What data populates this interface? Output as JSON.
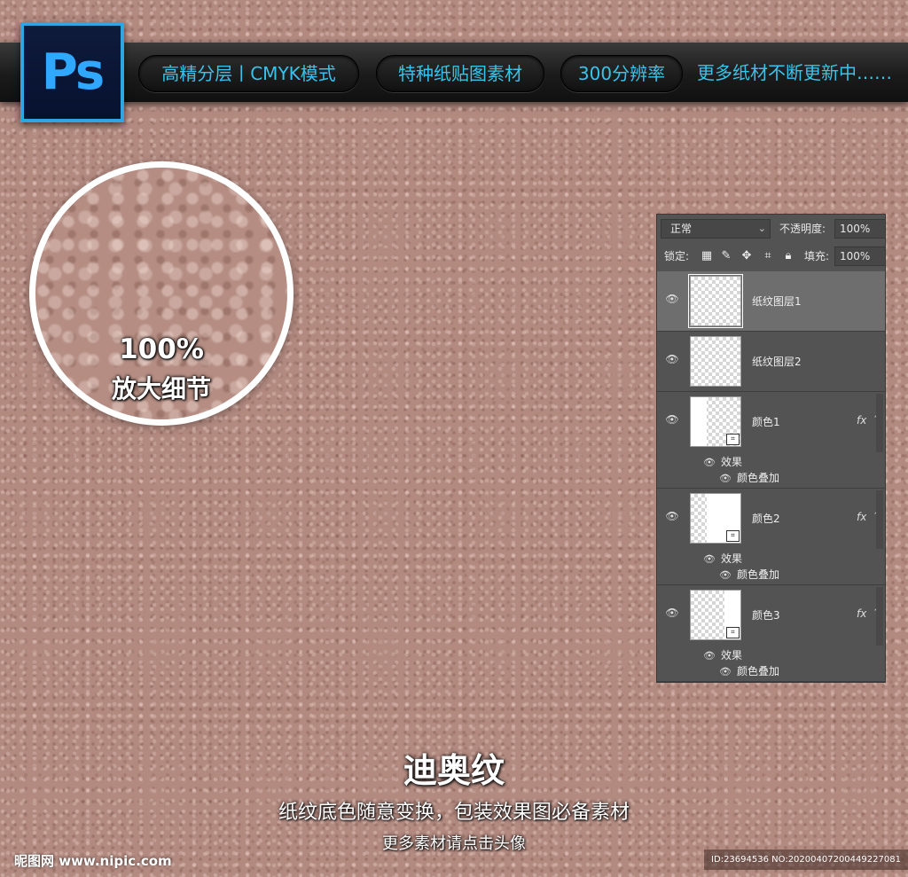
{
  "banner": {
    "logo_text": "Ps",
    "tags": [
      "高精分层丨CMYK模式",
      "特种纸贴图素材",
      "300分辨率"
    ],
    "note": "更多纸材不断更新中……"
  },
  "magnifier": {
    "percent": "100%",
    "label": "放大细节"
  },
  "layers_panel": {
    "blend_mode": "正常",
    "opacity_label": "不透明度:",
    "opacity_value": "100%",
    "lock_label": "锁定:",
    "fill_label": "填充:",
    "fill_value": "100%",
    "layers": [
      {
        "name": "纸纹图层1",
        "selected": true
      },
      {
        "name": "纸纹图层2",
        "selected": false
      },
      {
        "name": "颜色1",
        "fx": "fx",
        "effects_label": "效果",
        "effect": "颜色叠加"
      },
      {
        "name": "颜色2",
        "fx": "fx",
        "effects_label": "效果",
        "effect": "颜色叠加"
      },
      {
        "name": "颜色3",
        "fx": "fx",
        "effects_label": "效果",
        "effect": "颜色叠加"
      }
    ]
  },
  "footer": {
    "title": "迪奥纹",
    "subtitle": "纸纹底色随意变换，包装效果图必备素材",
    "note": "更多素材请点击头像",
    "watermark_site": "昵图网 www.nipic.com",
    "watermark_id": "ID:23694536 NO:20200407200449227081"
  },
  "colors": {
    "background": "#b38a80",
    "accent_cyan": "#39c3eb",
    "ps_blue": "#31a8ff",
    "panel_bg": "#535353"
  }
}
